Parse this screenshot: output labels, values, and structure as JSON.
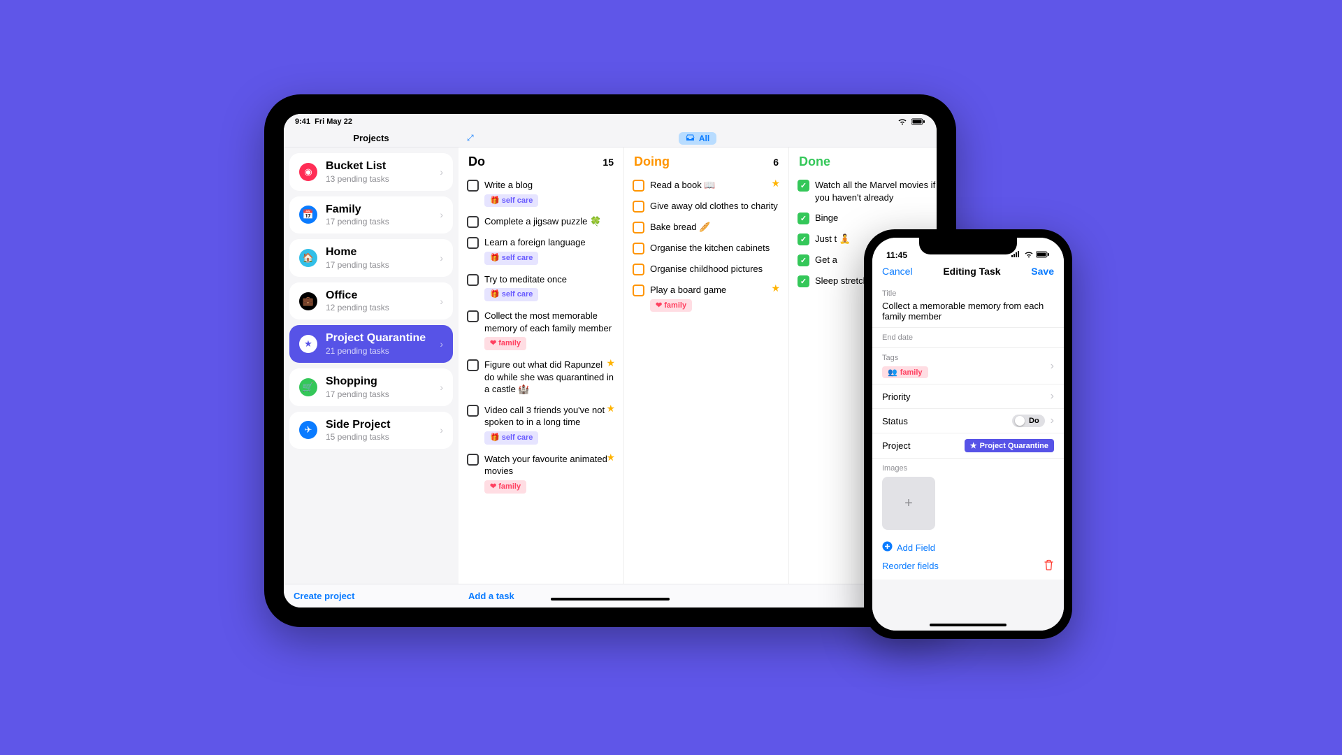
{
  "ipad": {
    "status_time": "9:41",
    "status_date": "Fri May 22",
    "header_title": "Projects",
    "filter_label": "All",
    "footer_left": "Create project",
    "footer_right": "Add a task"
  },
  "projects": [
    {
      "name": "Bucket List",
      "sub": "13 pending tasks",
      "color": "#ff2d55",
      "glyph": "◉"
    },
    {
      "name": "Family",
      "sub": "17 pending tasks",
      "color": "#0a7bff",
      "glyph": "📅"
    },
    {
      "name": "Home",
      "sub": "17 pending tasks",
      "color": "#32bfe8",
      "glyph": "🏠"
    },
    {
      "name": "Office",
      "sub": "12 pending tasks",
      "color": "#000000",
      "glyph": "💼"
    },
    {
      "name": "Project Quarantine",
      "sub": "21 pending tasks",
      "color": "#ffffff",
      "glyph": "★",
      "selected": true
    },
    {
      "name": "Shopping",
      "sub": "17 pending tasks",
      "color": "#34c759",
      "glyph": "🛒"
    },
    {
      "name": "Side Project",
      "sub": "15 pending tasks",
      "color": "#0a7bff",
      "glyph": "✈"
    }
  ],
  "columns": {
    "do": {
      "title": "Do",
      "count": "15"
    },
    "doing": {
      "title": "Doing",
      "count": "6"
    },
    "done": {
      "title": "Done",
      "count": ""
    }
  },
  "tasks": {
    "do": [
      {
        "text": "Write a blog",
        "tag": "self care",
        "tagType": "selfcare"
      },
      {
        "text": "Complete a jigsaw puzzle 🍀"
      },
      {
        "text": "Learn a foreign language",
        "tag": "self care",
        "tagType": "selfcare"
      },
      {
        "text": "Try to meditate once",
        "tag": "self care",
        "tagType": "selfcare"
      },
      {
        "text": "Collect the most memorable memory of each family member",
        "tag": "family",
        "tagType": "family"
      },
      {
        "text": "Figure out what did Rapunzel do while she was quarantined in a castle 🏰",
        "star": true
      },
      {
        "text": "Video call 3 friends you've not spoken to in a long time",
        "tag": "self care",
        "tagType": "selfcare",
        "star": true
      },
      {
        "text": "Watch your favourite animated movies",
        "tag": "family",
        "tagType": "family",
        "star": true
      }
    ],
    "doing": [
      {
        "text": "Read a book 📖",
        "star": true
      },
      {
        "text": "Give away old clothes to charity"
      },
      {
        "text": "Bake bread 🥖"
      },
      {
        "text": "Organise the kitchen cabinets"
      },
      {
        "text": "Organise childhood pictures"
      },
      {
        "text": "Play a board game",
        "tag": "family",
        "tagType": "family",
        "star": true
      }
    ],
    "done": [
      {
        "text": "Watch all the Marvel movies if you haven't already"
      },
      {
        "text": "Binge"
      },
      {
        "text": "Just t 🧘"
      },
      {
        "text": "Get a"
      },
      {
        "text": "Sleep stretch"
      }
    ]
  },
  "iphone": {
    "time": "11:45",
    "cancel": "Cancel",
    "title": "Editing Task",
    "save": "Save",
    "fields": {
      "title_label": "Title",
      "title_value": "Collect a memorable memory from each family member",
      "enddate_label": "End date",
      "tags_label": "Tags",
      "tag_value": "family",
      "priority_label": "Priority",
      "status_label": "Status",
      "status_value": "Do",
      "project_label": "Project",
      "project_value": "Project Quarantine",
      "images_label": "Images"
    },
    "add_field": "Add Field",
    "reorder": "Reorder fields"
  }
}
